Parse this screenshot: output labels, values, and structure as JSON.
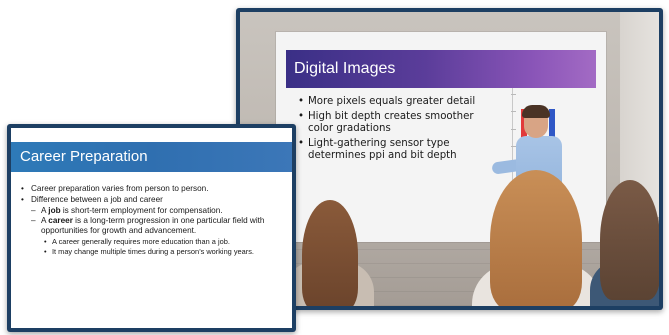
{
  "photo": {
    "slide_title": "Digital Images",
    "bullets": [
      "More pixels equals greater detail",
      "High bit depth creates smoother color gradations",
      "Light-gathering sensor type determines ppi and bit depth"
    ],
    "chart_data": {
      "type": "bar",
      "bar_colors": [
        "#e23a3a",
        "#39a94b",
        "#2f57c6"
      ],
      "values": [
        0.88,
        0.88,
        0.88
      ]
    }
  },
  "slide": {
    "title": "Career Preparation",
    "items": [
      {
        "level": 1,
        "text": "Career preparation varies from person to person."
      },
      {
        "level": 1,
        "text": "Difference between a job and career"
      },
      {
        "level": 2,
        "prefix": "A ",
        "bold": "job",
        "suffix": " is short-term employment for compensation."
      },
      {
        "level": 2,
        "prefix": "A ",
        "bold": "career",
        "suffix": " is a long-term progression in one particular field with opportunities for growth and advancement."
      },
      {
        "level": 3,
        "text": "A career generally requires more education than a job."
      },
      {
        "level": 3,
        "text": "It may change multiple times during a person’s working years."
      }
    ]
  }
}
